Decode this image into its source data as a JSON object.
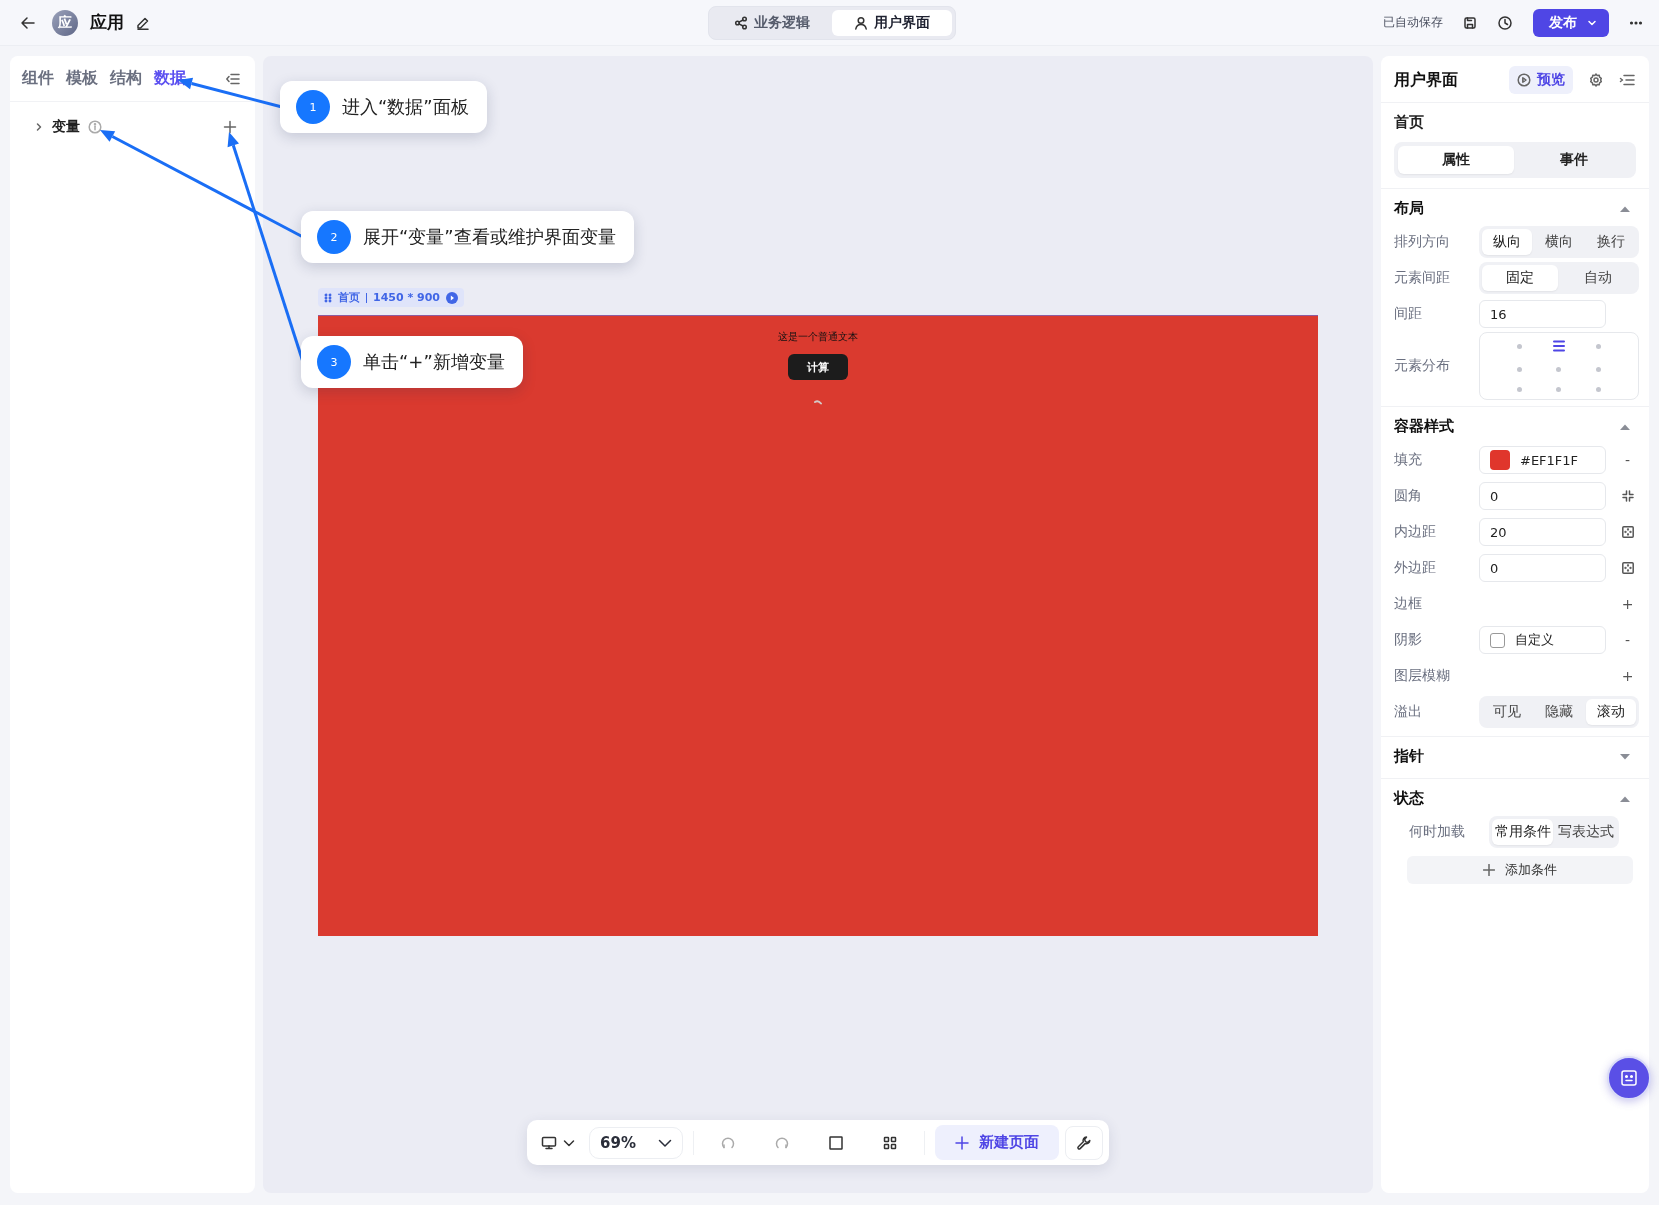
{
  "header": {
    "app_badge": "应",
    "app_name": "应用",
    "mode_tabs": [
      {
        "label": "业务逻辑",
        "selected": false
      },
      {
        "label": "用户界面",
        "selected": true
      }
    ],
    "autosave": "已自动保存",
    "publish": "发布"
  },
  "left_panel": {
    "tabs": [
      {
        "label": "组件",
        "selected": false
      },
      {
        "label": "模板",
        "selected": false
      },
      {
        "label": "结构",
        "selected": false
      },
      {
        "label": "数据",
        "selected": true
      }
    ],
    "tree": [
      {
        "label": "变量",
        "expanded": false
      }
    ]
  },
  "canvas": {
    "page_label": "首页",
    "page_size": "1450 * 900",
    "text": "这是一个普通文本",
    "button": "计算"
  },
  "toolbar": {
    "zoom": "69%",
    "new_page": "新建页面"
  },
  "right_panel": {
    "title": "用户界面",
    "preview": "预览",
    "page_name": "首页",
    "tabs": [
      {
        "label": "属性",
        "selected": true
      },
      {
        "label": "事件",
        "selected": false
      }
    ],
    "sections": [
      {
        "title": "布局",
        "expanded": true,
        "rows": [
          {
            "kind": "segmented",
            "label": "排列方向",
            "options": [
              {
                "label": "纵向",
                "selected": true
              },
              {
                "label": "横向",
                "selected": false
              },
              {
                "label": "换行",
                "selected": false
              }
            ]
          },
          {
            "kind": "segmented",
            "label": "元素间距",
            "options": [
              {
                "label": "固定",
                "selected": true
              },
              {
                "label": "自动",
                "selected": false
              }
            ]
          },
          {
            "kind": "input",
            "label": "间距",
            "value": "16"
          },
          {
            "kind": "align",
            "label": "元素分布",
            "cells": [
              {
                "selected": false
              },
              {
                "selected": true
              },
              {
                "selected": false
              },
              {
                "selected": false
              },
              {
                "selected": false
              },
              {
                "selected": false
              },
              {
                "selected": false
              },
              {
                "selected": false
              },
              {
                "selected": false
              }
            ]
          }
        ]
      },
      {
        "title": "容器样式",
        "expanded": true,
        "rows": [
          {
            "kind": "color",
            "label": "填充",
            "value": "#EF1F1F",
            "trailing": {
              "kind": "text",
              "text": "-"
            }
          },
          {
            "kind": "input",
            "label": "圆角",
            "value": "0",
            "trailing": {
              "kind": "radius"
            }
          },
          {
            "kind": "input",
            "label": "内边距",
            "value": "20",
            "trailing": {
              "kind": "spacing"
            }
          },
          {
            "kind": "input",
            "label": "外边距",
            "value": "0",
            "trailing": {
              "kind": "spacing"
            }
          },
          {
            "kind": "empty",
            "label": "边框",
            "trailing": {
              "kind": "text",
              "text": "+"
            }
          },
          {
            "kind": "checkbox",
            "label": "阴影",
            "value": "自定义",
            "checked": false,
            "trailing": {
              "kind": "text",
              "text": "-"
            }
          },
          {
            "kind": "empty",
            "label": "图层模糊",
            "trailing": {
              "kind": "text",
              "text": "+"
            }
          },
          {
            "kind": "segmented",
            "label": "溢出",
            "options": [
              {
                "label": "可见",
                "selected": false
              },
              {
                "label": "隐藏",
                "selected": false
              },
              {
                "label": "滚动",
                "selected": true
              }
            ]
          }
        ]
      },
      {
        "title": "指针",
        "expanded": false
      },
      {
        "title": "状态",
        "expanded": true,
        "rows": [
          {
            "kind": "segmented",
            "label": "何时加载",
            "options": [
              {
                "label": "常用条件",
                "selected": true
              },
              {
                "label": "写表达式",
                "selected": false
              }
            ]
          },
          {
            "kind": "button",
            "label": "添加条件"
          }
        ]
      }
    ]
  },
  "callouts": [
    {
      "number": "1",
      "text": "进入“数据”面板"
    },
    {
      "number": "2",
      "text": "展开“变量”查看或维护界面变量"
    },
    {
      "number": "3",
      "text": "单击“+”新增变量"
    }
  ]
}
